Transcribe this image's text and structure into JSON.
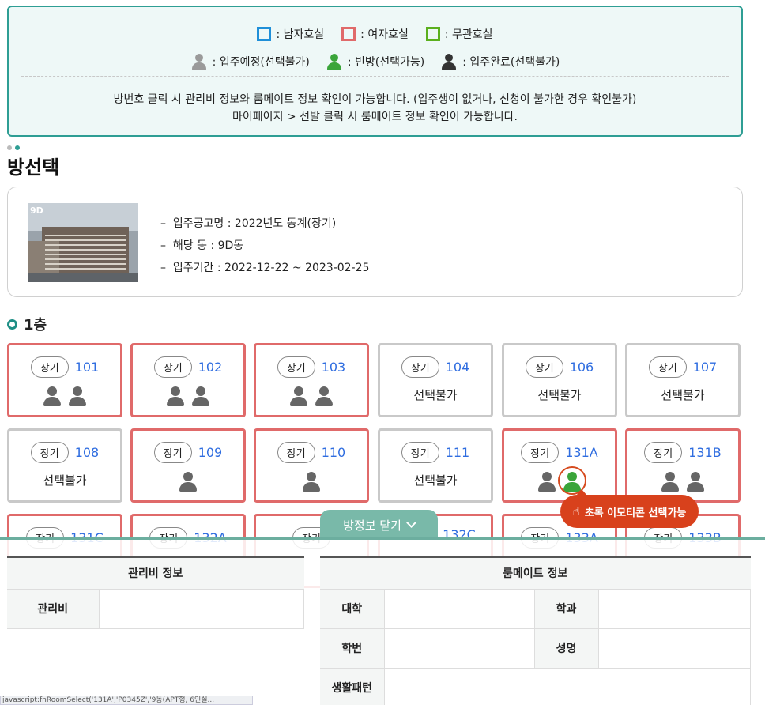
{
  "notice": {
    "legend_type": [
      {
        "label": ": 남자호실",
        "color": "#1f8fd8"
      },
      {
        "label": ": 여자호실",
        "color": "#e06a6a"
      },
      {
        "label": ": 무관호실",
        "color": "#5bb01e"
      }
    ],
    "legend_status": [
      {
        "label": ": 입주예정(선택불가)",
        "color": "#9a9a9a"
      },
      {
        "label": ": 빈방(선택가능)",
        "color": "#3aa53a"
      },
      {
        "label": ": 입주완료(선택불가)",
        "color": "#333333"
      }
    ],
    "line1": "방번호 클릭 시 관리비 정보와 룸메이트 정보 확인이 가능합니다. (입주생이 없거나, 신청이 불가한 경우 확인불가)",
    "line2": "마이페이지 > 선발 클릭 시 룸메이트 정보 확인이 가능합니다."
  },
  "page_title": "방선택",
  "building": {
    "thumb_label": "9D",
    "items": [
      "입주공고명 : 2022년도 동계(장기)",
      "해당 동 : 9D동",
      "입주기간 : 2022-12-22 ~ 2023-02-25"
    ],
    "bullet": "–"
  },
  "floor_title": "1층",
  "rooms_row1": [
    {
      "tag": "장기",
      "no": "101",
      "unavailable": ""
    },
    {
      "tag": "장기",
      "no": "102",
      "unavailable": ""
    },
    {
      "tag": "장기",
      "no": "103",
      "unavailable": ""
    },
    {
      "tag": "장기",
      "no": "104",
      "unavailable": "선택불가"
    },
    {
      "tag": "장기",
      "no": "106",
      "unavailable": "선택불가"
    },
    {
      "tag": "장기",
      "no": "107",
      "unavailable": "선택불가"
    }
  ],
  "rooms_row2": [
    {
      "tag": "장기",
      "no": "108",
      "unavailable": "선택불가"
    },
    {
      "tag": "장기",
      "no": "109",
      "unavailable": ""
    },
    {
      "tag": "장기",
      "no": "110",
      "unavailable": ""
    },
    {
      "tag": "장기",
      "no": "111",
      "unavailable": "선택불가"
    },
    {
      "tag": "장기",
      "no": "131A",
      "unavailable": ""
    },
    {
      "tag": "장기",
      "no": "131B",
      "unavailable": ""
    }
  ],
  "rooms_row3": [
    {
      "tag": "장기",
      "no": "131C"
    },
    {
      "tag": "장기",
      "no": "132A"
    },
    {
      "tag": "장기",
      "no": ""
    },
    {
      "tag": "",
      "no": "132C"
    },
    {
      "tag": "장기",
      "no": "133A"
    },
    {
      "tag": "장기",
      "no": "133B"
    }
  ],
  "callout": "초록 이모티콘 선택가능",
  "close_button": "방정보 닫기",
  "fee_table": {
    "header": "관리비 정보",
    "label": "관리비",
    "value": ""
  },
  "mate_table": {
    "header": "룸메이트 정보",
    "university": "대학",
    "department": "학과",
    "student_no": "학번",
    "name": "성명",
    "lifestyle": "생활패턴"
  },
  "status_bar": "javascript:fnRoomSelect('131A','P0345Z','9동(APT형, 6인실..."
}
